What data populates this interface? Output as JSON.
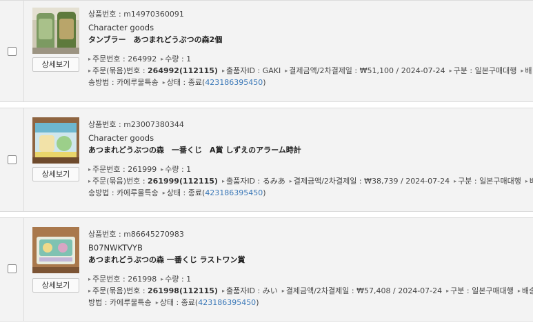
{
  "common": {
    "detail_button": "상세보기",
    "label_product_no": "상품번호 : ",
    "label_order_no": "주문번호 : ",
    "label_qty": "수량 : ",
    "label_bundle_no": "주문(묶음)번호 : ",
    "label_seller": "출품자ID : ",
    "label_payment": "결제금액/2차결제일 : ",
    "label_type": "구분 : ",
    "label_ship_prefix": "배",
    "label_ship_prefix_long": "배송",
    "label_ship_suffix": "송방법 : ",
    "label_ship_suffix_long": "방법 : ",
    "label_status": "상태 : ",
    "sep": " / ",
    "paren_open": "(",
    "paren_close": ")"
  },
  "orders": [
    {
      "product_no": "m14970360091",
      "brand": "Character goods",
      "title": "タンブラー　あつまれどうぶつの森2個",
      "order_no": "264992",
      "qty": "1",
      "bundle_no": "264992(112115)",
      "seller": "GAKI",
      "amount": "₩51,100",
      "date": "2024-07-24",
      "type": "일본구매대행",
      "ship_method": "카에루물특송",
      "status": "종료",
      "tracking": "423186395450",
      "thumb_colors": [
        "#7a8f5a",
        "#d8cfa8",
        "#5f7a3a"
      ]
    },
    {
      "product_no": "m23007380344",
      "brand": "Character goods",
      "title": "あつまれどうぶつの森　一番くじ　A賞 しずえのアラーム時計",
      "order_no": "261999",
      "qty": "1",
      "bundle_no": "261999(112115)",
      "seller": "るみあ",
      "amount": "₩38,739",
      "date": "2024-07-24",
      "type": "일본구매대행",
      "ship_method": "카에루물특송",
      "status": "종료",
      "tracking": "423186395450",
      "thumb_colors": [
        "#9c6a3c",
        "#7fc4d8",
        "#e0d6b0"
      ]
    },
    {
      "product_no": "m86645270983",
      "brand": "B07NWKTVYB",
      "title": "あつまれどうぶつの森 一番くじ ラストワン賞",
      "order_no": "261998",
      "qty": "1",
      "bundle_no": "261998(112115)",
      "seller": "みい",
      "amount": "₩57,408",
      "date": "2024-07-24",
      "type": "일본구매대행",
      "ship_method": "카에루물특송",
      "status": "종료",
      "tracking": "423186395450",
      "thumb_colors": [
        "#a86a3a",
        "#8fc7b8",
        "#e8e0c8"
      ]
    }
  ]
}
